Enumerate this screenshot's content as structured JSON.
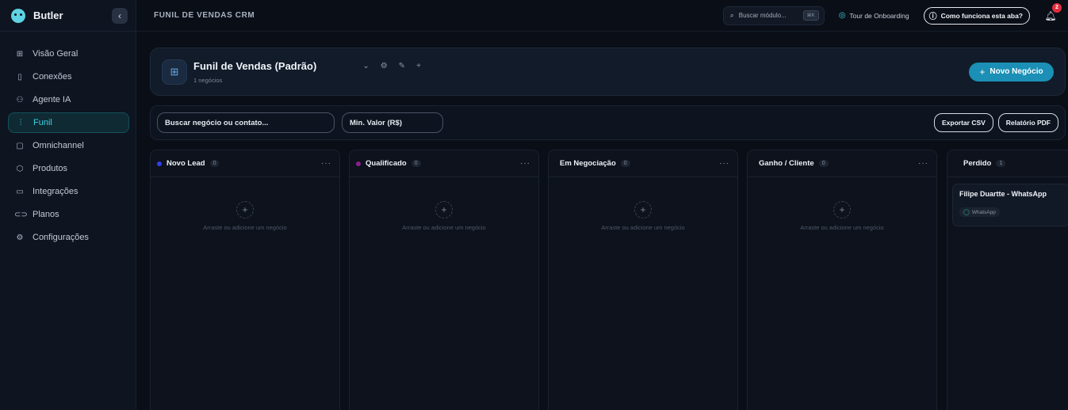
{
  "sidebar": {
    "brand": "Butler",
    "collapse_icon": "‹",
    "items": [
      {
        "label": "Visão Geral",
        "icon": "⊞",
        "active": false
      },
      {
        "label": "Conexões",
        "icon": "▯",
        "active": false
      },
      {
        "label": "Agente IA",
        "icon": "⚇",
        "active": false
      },
      {
        "label": "Funil",
        "icon": "⫶",
        "active": true
      },
      {
        "label": "Omnichannel",
        "icon": "▢",
        "active": false
      },
      {
        "label": "Produtos",
        "icon": "⬡",
        "active": false
      },
      {
        "label": "Integrações",
        "icon": "▭",
        "active": false
      },
      {
        "label": "Planos",
        "icon": "⊂⊃",
        "active": false
      },
      {
        "label": "Configurações",
        "icon": "⚙",
        "active": false
      }
    ]
  },
  "topbar": {
    "title": "FUNIL DE VENDAS CRM",
    "search_label": "Buscar módulo...",
    "search_shortcut": "⌘K",
    "tour_label": "Tour de Onboarding",
    "help_label": "Como funciona esta aba?",
    "notifications_count": "2"
  },
  "funnel": {
    "name": "Funil de Vendas (Padrão)",
    "deal_count": "1 negócios",
    "new_deal_label": "Novo Negócio"
  },
  "filters": {
    "search_placeholder": "Buscar negócio ou contato...",
    "min_value_placeholder": "Min. Valor (R$)",
    "export_csv_label": "Exportar CSV",
    "report_pdf_label": "Relatório PDF"
  },
  "board": {
    "empty_text": "Arraste ou adicione um negócio",
    "columns": [
      {
        "title": "Novo Lead",
        "count": "0",
        "color": "#2f3ff0"
      },
      {
        "title": "Qualificado",
        "count": "0",
        "color": "#8a1f8f"
      },
      {
        "title": "Em Negociação",
        "count": "0",
        "color": ""
      },
      {
        "title": "Ganho / Cliente",
        "count": "0",
        "color": ""
      },
      {
        "title": "Perdido",
        "count": "1",
        "color": ""
      }
    ],
    "deal": {
      "title": "Filipe Duartte - WhatsApp",
      "tag": "WhatsApp"
    }
  },
  "colors": {
    "accent": "#3fd0e0",
    "primary_button": "#1b8fb5",
    "badge": "#e12d3d"
  }
}
